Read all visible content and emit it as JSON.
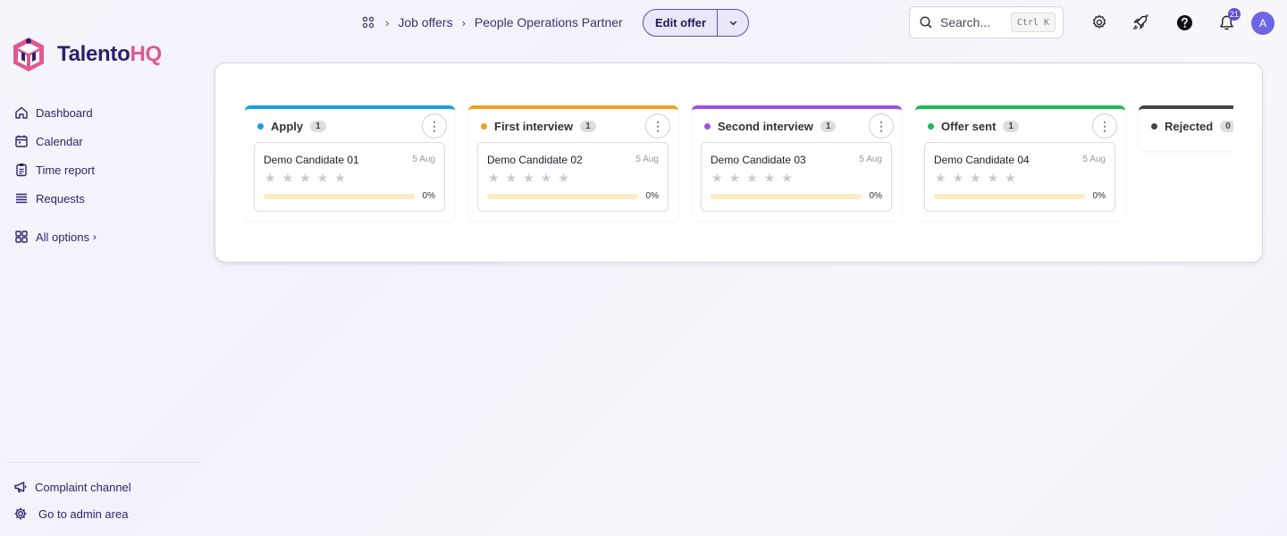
{
  "brand": {
    "name_part1": "Talento",
    "name_part2": "HQ",
    "primary": "#2d1f6e",
    "accent": "#e0588f"
  },
  "sidebar": {
    "items": [
      {
        "label": "Dashboard",
        "icon": "home-icon"
      },
      {
        "label": "Calendar",
        "icon": "calendar-icon"
      },
      {
        "label": "Time report",
        "icon": "clipboard-icon"
      },
      {
        "label": "Requests",
        "icon": "list-icon"
      }
    ],
    "all_options": "All options",
    "bottom": [
      {
        "label": "Complaint channel",
        "icon": "megaphone-icon"
      },
      {
        "label": "Go to admin area",
        "icon": "gear-icon"
      }
    ]
  },
  "header": {
    "breadcrumb": [
      "Job offers",
      "People Operations Partner"
    ],
    "edit_button": "Edit offer",
    "search_placeholder": "Search...",
    "search_shortcut": "Ctrl K",
    "notification_count": "21",
    "avatar_initial": "A"
  },
  "board": {
    "columns": [
      {
        "title": "Apply",
        "count": "1",
        "color": "#1a9ee0",
        "candidate": "Demo Candidate 01",
        "date": "5 Aug",
        "progress_label": "0%",
        "progress": 0,
        "rating": 0
      },
      {
        "title": "First interview",
        "count": "1",
        "color": "#f0a020",
        "candidate": "Demo Candidate 02",
        "date": "5 Aug",
        "progress_label": "0%",
        "progress": 0,
        "rating": 0
      },
      {
        "title": "Second interview",
        "count": "1",
        "color": "#a04fe0",
        "candidate": "Demo Candidate 03",
        "date": "5 Aug",
        "progress_label": "0%",
        "progress": 0,
        "rating": 0
      },
      {
        "title": "Offer sent",
        "count": "1",
        "color": "#1db954",
        "candidate": "Demo Candidate 04",
        "date": "5 Aug",
        "progress_label": "0%",
        "progress": 0,
        "rating": 0
      },
      {
        "title": "Rejected",
        "count": "0",
        "color": "#444444"
      }
    ]
  }
}
